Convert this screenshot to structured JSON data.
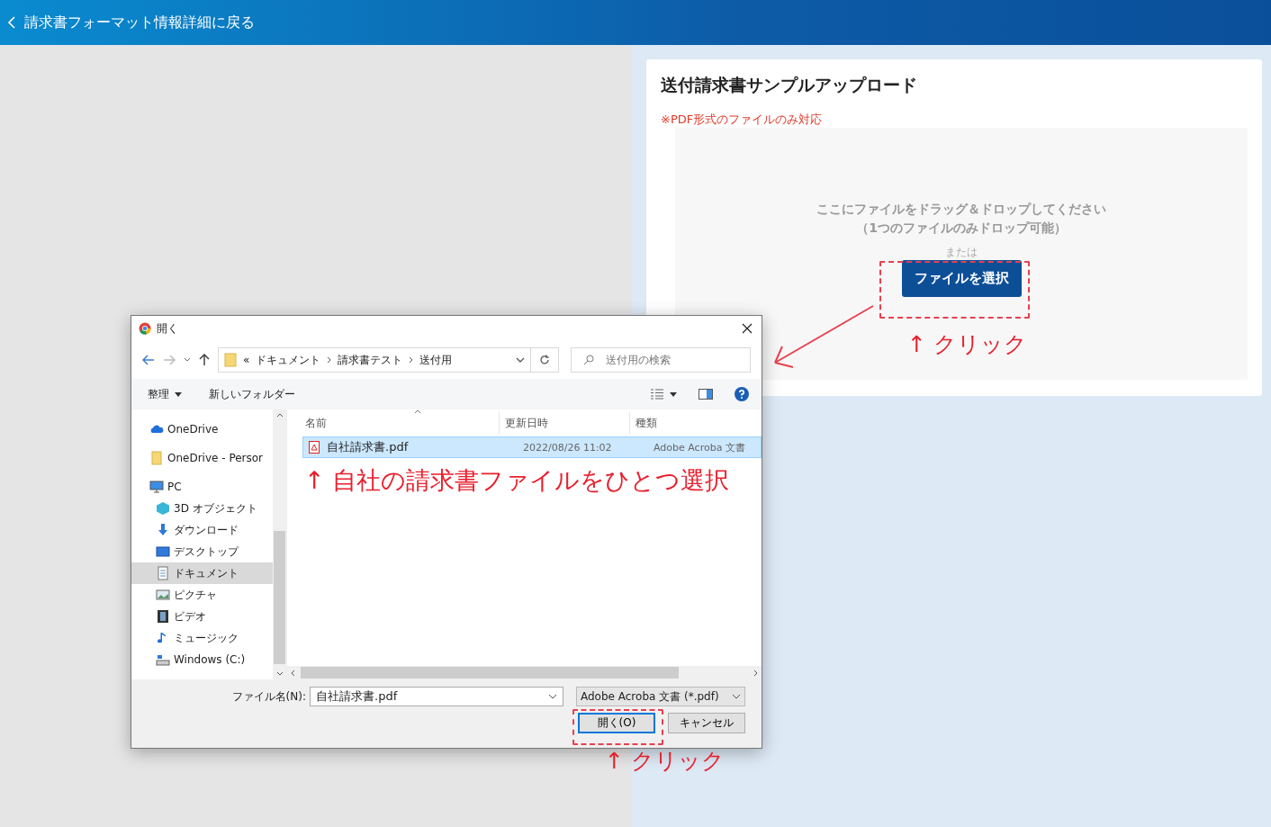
{
  "header": {
    "back_link": "請求書フォーマット情報詳細に戻る"
  },
  "upload_card": {
    "title": "送付請求書サンプルアップロード",
    "note": "※PDF形式のファイルのみ対応",
    "drop_text": "ここにファイルをドラッグ＆ドロップしてください",
    "drop_subtext": "（1つのファイルのみドロップ可能）",
    "or_text": "または",
    "select_button": "ファイルを選択"
  },
  "dialog": {
    "title": "開く",
    "breadcrumb": {
      "overflow": "«",
      "items": [
        "ドキュメント",
        "請求書テスト",
        "送付用"
      ]
    },
    "search": {
      "placeholder": "送付用の検索"
    },
    "toolbar": [
      "整理",
      "新しいフォルダー"
    ],
    "sidebar": [
      {
        "label": "OneDrive",
        "kind": "cloud",
        "selected": false
      },
      {
        "label": "OneDrive - Persor",
        "kind": "folder",
        "selected": false
      },
      {
        "label": "PC",
        "kind": "pc",
        "selected": false,
        "children": [
          {
            "label": "3D オブジェクト",
            "kind": "cube",
            "selected": false
          },
          {
            "label": "ダウンロード",
            "kind": "download",
            "selected": false
          },
          {
            "label": "デスクトップ",
            "kind": "desktop",
            "selected": false
          },
          {
            "label": "ドキュメント",
            "kind": "document",
            "selected": true
          },
          {
            "label": "ピクチャ",
            "kind": "picture",
            "selected": false
          },
          {
            "label": "ビデオ",
            "kind": "video",
            "selected": false
          },
          {
            "label": "ミュージック",
            "kind": "music",
            "selected": false
          },
          {
            "label": "Windows (C:)",
            "kind": "drive",
            "selected": false
          }
        ]
      }
    ],
    "columns": [
      "名前",
      "更新日時",
      "種類"
    ],
    "files": [
      {
        "name": "自社請求書.pdf",
        "modified": "2022/08/26 11:02",
        "type": "Adobe Acroba 文書",
        "selected": true
      }
    ],
    "filename_label": "ファイル名(N):",
    "filename_value": "自社請求書.pdf",
    "filter": "Adobe Acroba 文書 (*.pdf)",
    "buttons": [
      "開く(O)",
      "キャンセル"
    ]
  },
  "annotations": {
    "file_hint": "↑ 自社の請求書ファイルをひとつ選択",
    "click_hint_select": "↑ クリック",
    "click_hint_open": "↑ クリック"
  }
}
